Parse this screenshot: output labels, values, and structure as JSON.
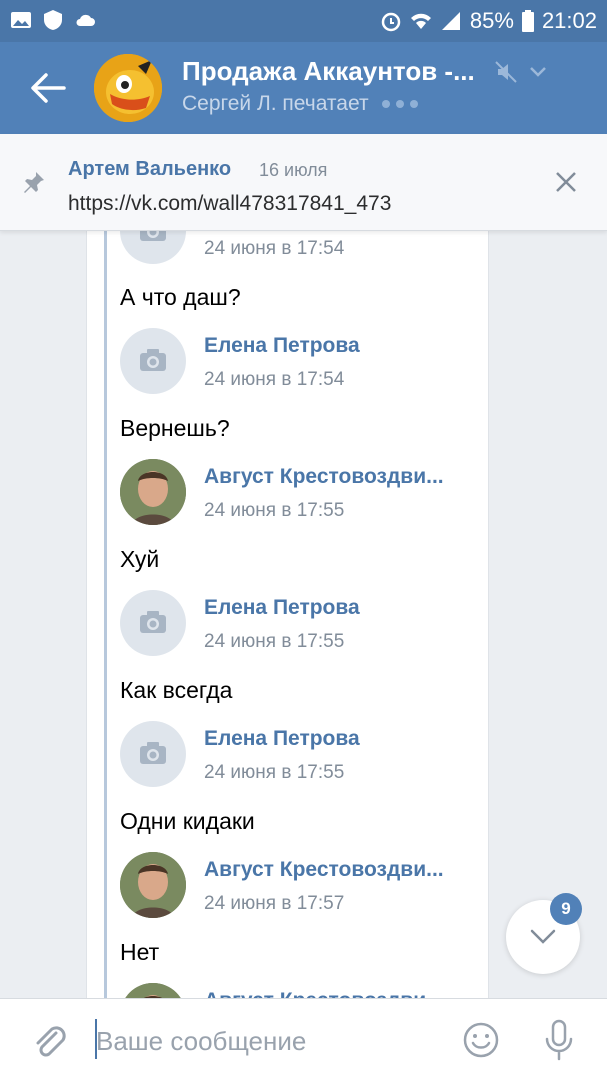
{
  "status_bar": {
    "battery": "85%",
    "time": "21:02"
  },
  "header": {
    "title": "Продажа Аккаунтов -...",
    "subtitle": "Сергей Л. печатает"
  },
  "pinned": {
    "author": "Артем Вальенко",
    "date": "16 июля",
    "link": "https://vk.com/wall478317841_473"
  },
  "messages": [
    {
      "time": "24 июня в 17:54",
      "text": "А что даш?"
    },
    {
      "name": "Елена Петрова",
      "time": "24 июня в 17:54",
      "text": "Вернешь?"
    },
    {
      "name": "Август Крестовоздви...",
      "time": "24 июня в 17:55",
      "text": "Хуй"
    },
    {
      "name": "Елена Петрова",
      "time": "24 июня в 17:55",
      "text": "Как всегда"
    },
    {
      "name": "Елена Петрова",
      "time": "24 июня в 17:55",
      "text": "Одни кидаки"
    },
    {
      "name": "Август Крестовоздви...",
      "time": "24 июня в 17:57",
      "text": "Нет"
    },
    {
      "name": "Август Крестовоздви..."
    }
  ],
  "unread_badge": "9",
  "input": {
    "placeholder": "Ваше сообщение"
  },
  "colors": {
    "header": "#5181b8",
    "status_bar": "#4a76a8",
    "link_name": "#4a76a8",
    "time": "#818c99"
  }
}
